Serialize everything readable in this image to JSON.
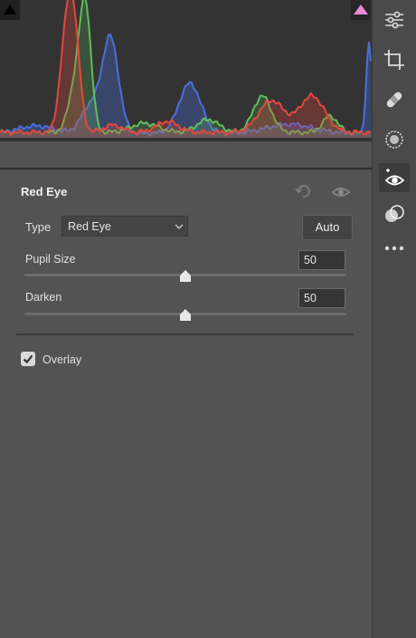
{
  "histogram": {
    "shadow_clip_icon": "shadow-clipping-warning",
    "highlight_clip_icon": "highlight-clipping-warning",
    "colors": {
      "red": "#e2483e",
      "green": "#5fbf5a",
      "blue": "#4a6fdc"
    }
  },
  "panel": {
    "title": "Red Eye",
    "type_label": "Type",
    "type_value": "Red Eye",
    "auto_label": "Auto",
    "sliders": [
      {
        "label": "Pupil Size",
        "value": "50",
        "fraction": 0.5
      },
      {
        "label": "Darken",
        "value": "50",
        "fraction": 0.5
      }
    ],
    "overlay_label": "Overlay",
    "overlay_checked": true
  },
  "toolbar": {
    "tools": [
      {
        "icon": "edit-sliders-icon",
        "active": false
      },
      {
        "icon": "crop-icon",
        "active": false
      },
      {
        "icon": "healing-bandage-icon",
        "active": false
      },
      {
        "icon": "masking-icon",
        "active": false
      },
      {
        "icon": "red-eye-icon",
        "active": true
      },
      {
        "icon": "presets-icon",
        "active": false
      },
      {
        "icon": "more-icon",
        "active": false
      }
    ]
  }
}
